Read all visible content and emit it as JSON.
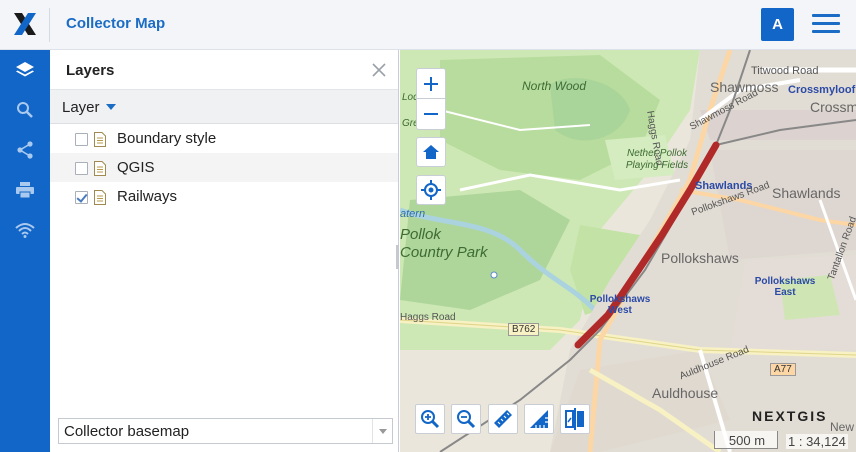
{
  "app": {
    "title": "Collector Map",
    "user_initial": "A"
  },
  "colors": {
    "brand_blue": "#1266c7",
    "railway": "#b02a2a"
  },
  "sidebar": {
    "items": [
      {
        "name": "layers",
        "icon": "layers-icon"
      },
      {
        "name": "search",
        "icon": "search-icon"
      },
      {
        "name": "share",
        "icon": "share-icon"
      },
      {
        "name": "print",
        "icon": "print-icon"
      },
      {
        "name": "wifi",
        "icon": "wifi-icon"
      }
    ]
  },
  "panel": {
    "title": "Layers",
    "column_header": "Layer",
    "layers": [
      {
        "label": "Boundary style",
        "checked": false
      },
      {
        "label": "QGIS",
        "checked": false
      },
      {
        "label": "Railways",
        "checked": true
      }
    ],
    "basemap": "Collector basemap"
  },
  "map": {
    "labels": {
      "titwood_road": "Titwood Road",
      "shawmoss": "Shawmoss",
      "crossmyloof": "Crossmyloof",
      "crossm": "Crossm",
      "north_wood": "North Wood",
      "haggs_road": "Haggs Road",
      "shawmoss_road": "Shawmoss Road",
      "nether_pollok": "Nether Pollok Playing Fields",
      "shawlands_station": "Shawlands",
      "shawlands": "Shawlands",
      "pollokshaws_road": "Pollokshaws Road",
      "pollok_country_park": "Pollok Country Park",
      "pollokshaws": "Pollokshaws",
      "pollokshaws_west": "Pollokshaws West",
      "pollokshaws_east": "Pollokshaws East",
      "tantallon_road": "Tantallon Road",
      "b762": "B762",
      "a77": "A77",
      "haggs_road_left": "Haggs Road",
      "aldhouse_road": "Auldhouse Road",
      "aldhouse": "Auldhouse",
      "new": "New",
      "loc_c": "Loc",
      "loc_g": "Gre",
      "waterln": "atern"
    },
    "brand": "NEXTGIS",
    "scale_bar": "500 m",
    "scale_ratio": "1 : 34,124"
  }
}
